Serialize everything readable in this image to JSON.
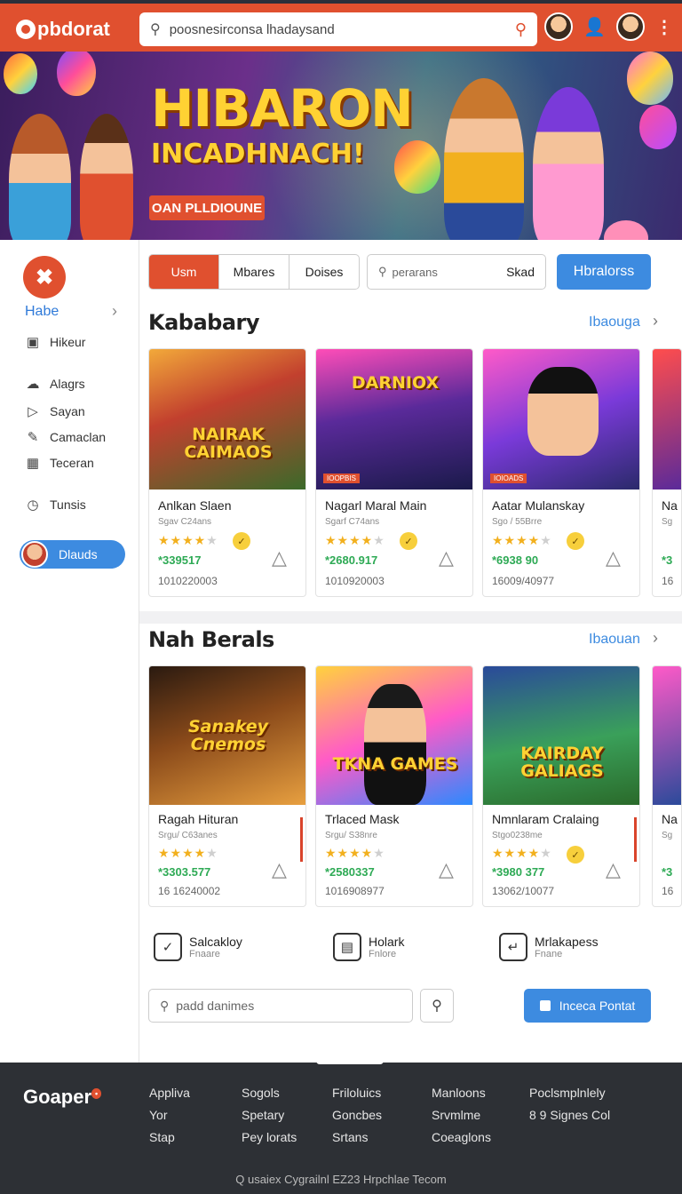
{
  "header": {
    "logo": "pbdorat",
    "search_text": "poosnesirconsa lhadaysand"
  },
  "hero": {
    "title": "HIBARON",
    "subtitle": "INCADHNACH!",
    "cta": "OAN PLLDIOUNE"
  },
  "sidebar": {
    "home": "Habe",
    "items": [
      {
        "label": "Hikeur",
        "icon": "lock-icon"
      },
      {
        "label": "Alagrs",
        "icon": "cloud-icon"
      },
      {
        "label": "Sayan",
        "icon": "tag-icon"
      },
      {
        "label": "Camaclan",
        "icon": "pen-icon"
      },
      {
        "label": "Teceran",
        "icon": "image-icon"
      },
      {
        "label": "Tunsis",
        "icon": "clock-icon"
      }
    ],
    "pill": "Dlauds"
  },
  "toolbar": {
    "segments": [
      "Usm",
      "Mbares",
      "Doises"
    ],
    "filter_placeholder": "perarans",
    "sort": "Skad",
    "action": "Hbralorss"
  },
  "section1": {
    "title": "Kababary",
    "more": "Ibaouga",
    "cards": [
      {
        "thumb_title": "NAIRAK CAIMAOS",
        "tag": "",
        "name": "Anlkan Slaen",
        "meta": "Sgav C24ans",
        "rating": 4,
        "price": "*339517",
        "pid": "1010220003"
      },
      {
        "thumb_title": "DARNIOX",
        "tag": "IOOPBIS",
        "name": "Nagarl Maral Main",
        "meta": "Sgarf C74ans",
        "rating": 4.5,
        "price": "*2680.917",
        "pid": "1010920003"
      },
      {
        "thumb_title": "",
        "tag": "IOIOADS",
        "name": "Aatar Mulanskay",
        "meta": "Sgo / 55Brre",
        "rating": 4,
        "price": "*6938 90",
        "pid": "16009/40977"
      },
      {
        "name": "Na",
        "meta": "Sg",
        "price": "*3",
        "pid": "16"
      }
    ]
  },
  "section2": {
    "title": "Nah Berals",
    "more": "Ibaouan",
    "cards": [
      {
        "thumb_title": "Sanakey Cnemos",
        "name": "Ragah Hituran",
        "meta": "Srgu/ C63anes",
        "rating": 4,
        "price": "*3303.577",
        "pid": "16 16240002"
      },
      {
        "thumb_title": "TKNA GAMES",
        "name": "Trlaced Mask",
        "meta": "Srgu/ S38nre",
        "rating": 4,
        "price": "*2580337",
        "pid": "1016908977"
      },
      {
        "thumb_title": "KAIRDAY GALIAGS",
        "name": "Nmnlaram Cralaing",
        "meta": "Stgo0238me",
        "rating": 4,
        "price": "*3980 377",
        "pid": "13062/10077"
      },
      {
        "name": "Na",
        "meta": "Sg",
        "price": "*3",
        "pid": "16"
      }
    ]
  },
  "features": [
    {
      "title": "Salcakloy",
      "sub": "Fnaare",
      "icon": "check-icon"
    },
    {
      "title": "Holark",
      "sub": "Fnlore",
      "icon": "lock-icon"
    },
    {
      "title": "Mrlakapess",
      "sub": "Fnane",
      "icon": "return-icon"
    }
  ],
  "bottom_search": {
    "placeholder": "padd danimes",
    "contact": "Inceca Pontat"
  },
  "footer": {
    "logo": "Goaper",
    "columns": [
      [
        "Appliva",
        "Yor",
        "Stap"
      ],
      [
        "Sogols",
        "Spetary",
        "Pey lorats"
      ],
      [
        "Friloluics",
        "Goncbes",
        "Srtans"
      ],
      [
        "Manloons",
        "Srvmlme",
        "Coeaglons"
      ],
      [
        "Poclsmplnlely",
        "8 9 Signes Col"
      ]
    ],
    "copyright": "Q usaiex Cygrailnl EZ23 Hrpchlae Tecom"
  },
  "colors": {
    "brand": "#e0502f",
    "accent": "#3d8be0",
    "price": "#2eaa55",
    "star": "#f2b01e"
  }
}
